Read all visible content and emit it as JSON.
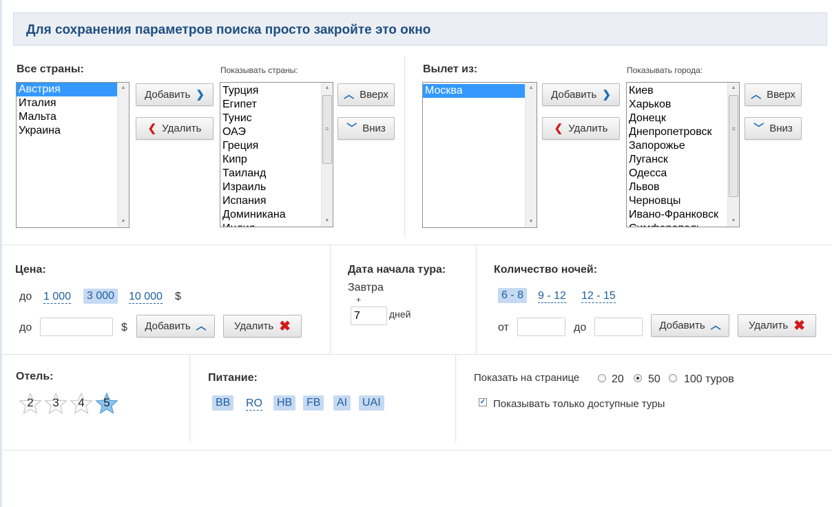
{
  "banner": {
    "text": "Для сохранения параметров поиска просто закройте это окно"
  },
  "countries": {
    "all_label": "Все страны:",
    "all_items": [
      "Австрия",
      "Италия",
      "Мальта",
      "Украина"
    ],
    "all_selected": "Австрия",
    "add_label": "Добавить",
    "remove_label": "Удалить",
    "shown_label": "Показывать страны:",
    "shown_items": [
      "Турция",
      "Египет",
      "Тунис",
      "ОАЭ",
      "Греция",
      "Кипр",
      "Таиланд",
      "Израиль",
      "Испания",
      "Доминикана",
      "Индия"
    ],
    "up_label": "Вверх",
    "down_label": "Вниз"
  },
  "departure": {
    "from_label": "Вылет из:",
    "from_items": [
      "Москва"
    ],
    "from_selected": "Москва",
    "add_label": "Добавить",
    "remove_label": "Удалить",
    "shown_label": "Показывать города:",
    "shown_items": [
      "Киев",
      "Харьков",
      "Донецк",
      "Днепропетровск",
      "Запорожье",
      "Луганск",
      "Одесса",
      "Львов",
      "Черновцы",
      "Ивано-Франковск",
      "Симферополь"
    ],
    "up_label": "Вверх",
    "down_label": "Вниз"
  },
  "price": {
    "label": "Цена:",
    "upto": "до",
    "options": [
      "1 000",
      "3 000",
      "10 000"
    ],
    "selected": "3 000",
    "currency": "$",
    "custom_prefix": "до",
    "custom_value": "",
    "add_label": "Добавить",
    "remove_label": "Удалить"
  },
  "date": {
    "label": "Дата начала тура:",
    "tomorrow": "Завтра",
    "plus": "+",
    "days_value": "7",
    "days_unit": "дней"
  },
  "nights": {
    "label": "Количество ночей:",
    "options": [
      "6 - 8",
      "9 - 12",
      "12 - 15"
    ],
    "selected": "6 - 8",
    "from_label": "от",
    "to_label": "до",
    "from_value": "",
    "to_value": "",
    "add_label": "Добавить",
    "remove_label": "Удалить"
  },
  "hotel": {
    "label": "Отель:",
    "stars": [
      "2",
      "3",
      "4",
      "5"
    ],
    "selected": "5"
  },
  "meals": {
    "label": "Питание:",
    "options": [
      "BB",
      "RO",
      "HB",
      "FB",
      "AI",
      "UAI"
    ],
    "unselected": [
      "RO"
    ]
  },
  "paging": {
    "label": "Показать на странице",
    "options": [
      "20",
      "50",
      "100 туров"
    ],
    "selected": "50",
    "only_available_label": "Показывать только доступные туры",
    "only_available_checked": true
  },
  "colors": {
    "accent": "#1f4f82",
    "chip_bg": "#c5daf2",
    "selection": "#3399ff",
    "remove": "#d31a1a",
    "star_selected": "#8cc4ef"
  }
}
